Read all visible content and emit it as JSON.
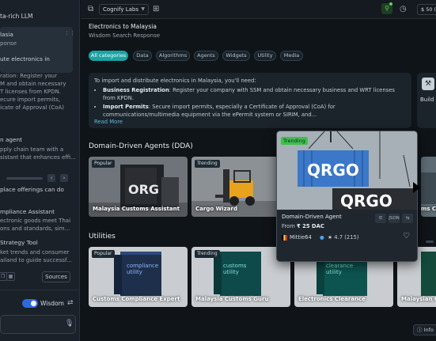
{
  "left": {
    "header": "ta-rich LLM",
    "items": [
      {
        "title": "lasia",
        "lines": [
          "ponse"
        ]
      },
      {
        "title": "ute electronics in",
        "lines": [
          "ration: Register your",
          "M and obtain necessary",
          "T licenses from KPDN.",
          "ecure import permits,",
          "icate of Approval (CoA)"
        ]
      },
      {
        "title": "n agent",
        "lines": [
          "pply chain team with a",
          "sistant that enhances effi..."
        ]
      },
      {
        "title": "place offerings can do",
        "lines": []
      },
      {
        "title": "mpliance Assistant",
        "lines": [
          "ectronic goods meet Thai",
          "ons and standards, sim..."
        ]
      },
      {
        "title": "Strategy Tool",
        "lines": [
          "ket trends and consumer",
          "ailand to guide successf..."
        ]
      }
    ],
    "sources_label": "Sources",
    "wisdom_label": "Wisdom",
    "input_placeholder": ""
  },
  "topbar": {
    "org": "Cognify Labs",
    "wallet": "$ 50 ("
  },
  "main": {
    "title": "Electronics to Malaysia",
    "subtitle": "Wisdom Search Response",
    "chips": [
      "All categories",
      "Data",
      "Algorithms",
      "Agents",
      "Widgets",
      "Utility",
      "Media"
    ],
    "response": {
      "intro": "To import and distribute electronics in Malaysia, you'll need:",
      "b1_label": "Business Registration",
      "b1_text": ": Register your company with SSM and obtain necessary business and WRT licenses from KPDN.",
      "b2_label": "Import Permits",
      "b2_text": ": Secure import permits, especially a Certificate of Approval (CoA) for communications/multimedia equipment via the ePermit system or SIRIM, and...",
      "more": "Read More"
    },
    "side_card": "Build y",
    "dda_title": "Domain-Driven Agents (DDA)",
    "dda_cards": [
      {
        "badge": "Popular",
        "name": "Malaysia Customs Assistant"
      },
      {
        "badge": "Trending",
        "name": "Cargo Wizard"
      }
    ],
    "utilities_title": "Utilities",
    "utility_cards": [
      {
        "badge": "Popular",
        "name": "Customs Compliance Expert",
        "box_lines": [
          "compliance",
          "utility"
        ]
      },
      {
        "badge": "Trending",
        "name": "Malaysia Customs Guru",
        "box_lines": [
          "customs",
          "utility"
        ]
      },
      {
        "badge": "",
        "name": "Electronics Clearance",
        "box_lines": [
          "clearance",
          "utility"
        ]
      },
      {
        "badge": "",
        "name": "Malaysian C",
        "box_lines": []
      }
    ],
    "right_partial": "ms Co",
    "info": "Info"
  },
  "hover_card": {
    "badge": "Trending",
    "name": "Domain-Driven Agent",
    "price_prefix": "From",
    "price": "₹ 25 DAC",
    "user": "Mittie64",
    "rating": "★ 4.7 (215)",
    "container_text": "QRGO",
    "btn1": "☰",
    "btn2": "JSON",
    "btn3": "⇆"
  },
  "colors": {
    "accent": "#1aa3a3",
    "toggle": "#2d6ae0",
    "trending": "#3fbf4f",
    "link": "#5cb8e0"
  }
}
